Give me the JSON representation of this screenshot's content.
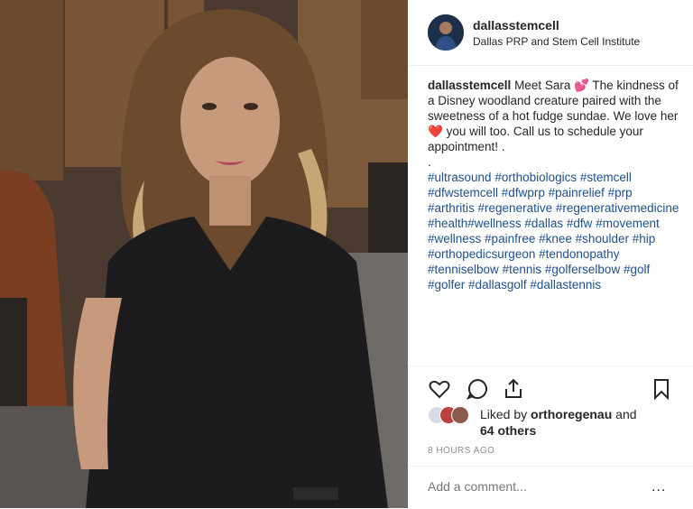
{
  "post": {
    "username": "dallasstemcell",
    "location": "Dallas PRP and Stem Cell Institute"
  },
  "caption": {
    "username": "dallasstemcell",
    "part1": " Meet Sara ",
    "emoji1": "💕",
    "part2": " The kindness of a Disney woodland creature paired with the sweetness of a hot fudge sundae. We love her ",
    "emoji2": "❤️",
    "part3": " you will too. Call us to schedule your appointment! .",
    "dot": ".",
    "hashtags": [
      "#ultrasound",
      "#orthobiologics",
      "#stemcell",
      "#dfwstemcell",
      "#dfwprp",
      "#painrelief",
      "#prp",
      "#arthritis",
      "#regenerative",
      "#regenerativemedicine",
      "#health#wellness",
      "#dallas",
      "#dfw",
      "#movement",
      "#wellness",
      "#painfree",
      "#knee",
      "#shoulder",
      "#hip",
      "#orthopedicsurgeon",
      "#tendonopathy",
      "#tenniselbow",
      "#tennis",
      "#golferselbow",
      "#golf",
      "#golfer",
      "#dallasgolf",
      "#dallastennis"
    ]
  },
  "likes": {
    "prefix": "Liked by ",
    "user": "orthoregenau",
    "joiner": " and",
    "others": "64 others"
  },
  "timestamp": "8 HOURS AGO",
  "comment": {
    "placeholder": "Add a comment...",
    "more": "..."
  },
  "icons": [
    "heart-icon",
    "comment-icon",
    "share-icon",
    "bookmark-icon"
  ],
  "colors": {
    "hashtag": "#1f4f8a",
    "text": "#262626",
    "muted": "#8e8e8e"
  }
}
